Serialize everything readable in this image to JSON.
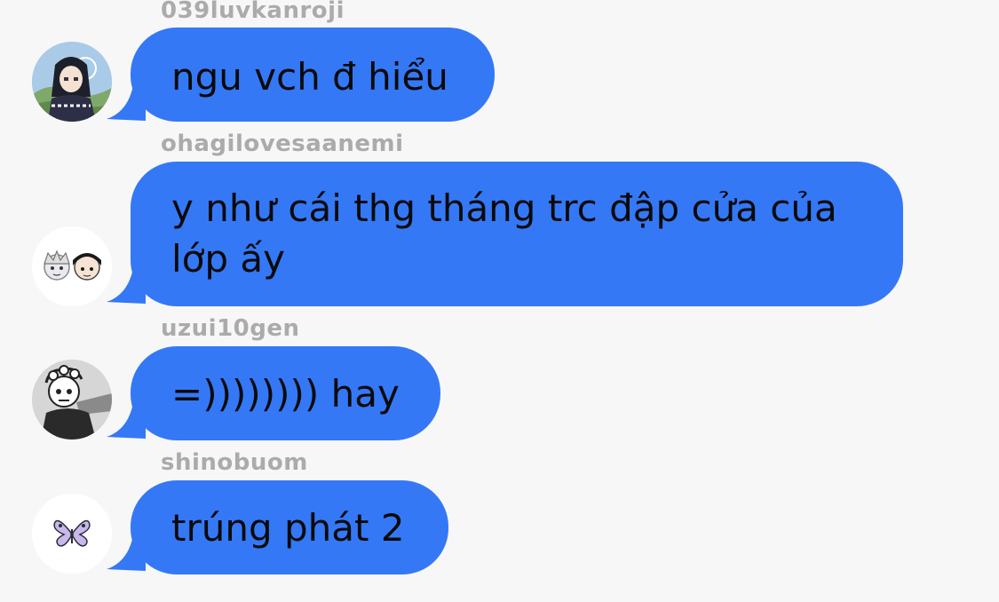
{
  "colors": {
    "background": "#f7f7f7",
    "bubble": "#3478f6",
    "message_text": "#0a0a0a",
    "username_text": "#ababab"
  },
  "messages": [
    {
      "username": "039luvkanroji",
      "avatar_icon": "anime-character-avatar-icon",
      "text": "ngu vch đ hiểu"
    },
    {
      "username": "ohagilovesaanemi",
      "avatar_icon": "two-chibi-characters-avatar-icon",
      "text": "y như cái thg tháng trc đập cửa của lớp ấy"
    },
    {
      "username": "uzui10gen",
      "avatar_icon": "manga-character-avatar-icon",
      "text": "=)))))))) hay"
    },
    {
      "username": "shinobuom",
      "avatar_icon": "butterfly-avatar-icon",
      "text": "trúng phát 2"
    }
  ]
}
